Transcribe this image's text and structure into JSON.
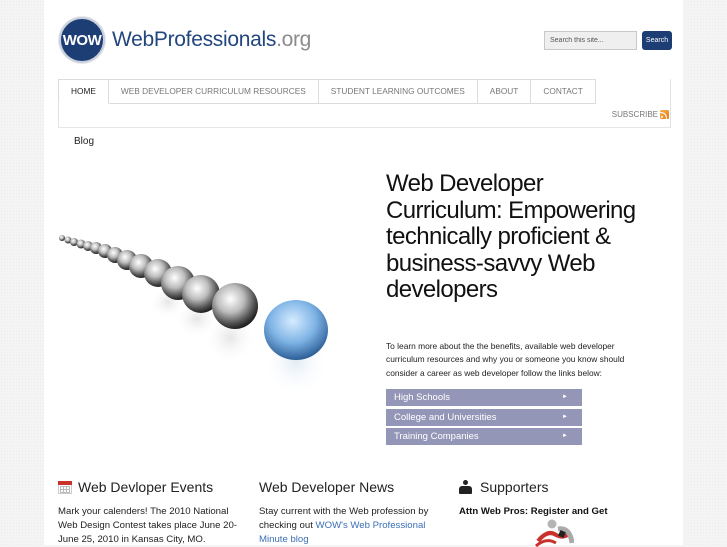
{
  "header": {
    "logo_badge": "WOW",
    "logo_name": "WebProfessionals",
    "logo_tld": ".org",
    "search": {
      "placeholder": "Search this site...",
      "button_label": "Search"
    }
  },
  "nav": {
    "tabs": [
      {
        "label": "HOME",
        "active": true
      },
      {
        "label": "WEB DEVELOPER CURRICULUM RESOURCES",
        "active": false
      },
      {
        "label": "STUDENT LEARNING OUTCOMES",
        "active": false
      },
      {
        "label": "ABOUT",
        "active": false
      },
      {
        "label": "CONTACT",
        "active": false
      }
    ],
    "subscribe_label": "SUBSCRIBE",
    "subnav": {
      "blog_label": "Blog"
    }
  },
  "hero": {
    "image_alt": "row of chrome spheres with one blue sphere",
    "title": "Web Developer Curriculum: Empowering technically proficient & business-savvy Web developers",
    "intro": "To learn more about the the benefits, available web developer curriculum resources and why you or someone you know should consider a career as web developer follow the links below:",
    "links": [
      {
        "label": "High Schools",
        "arrow": "►"
      },
      {
        "label": "College and Universities",
        "arrow": "►"
      },
      {
        "label": "Training Companies",
        "arrow": "►"
      }
    ],
    "link_color": "#9396b7"
  },
  "columns": {
    "events": {
      "title": "Web Devloper Events",
      "text": "Mark your calenders! The 2010 National Web Design Contest takes place June 20-June 25, 2010 in Kansas City, MO."
    },
    "news": {
      "title": "Web Developer News",
      "text_before": "Stay current with the Web profession by checking out ",
      "link_text": "WOW's Web Professional Minute blog"
    },
    "supporters": {
      "title": "Supporters",
      "attn": "Attn Web Pros: Register and Get"
    }
  },
  "colors": {
    "brand": "#1d3e74",
    "link": "#3a6fb5"
  }
}
